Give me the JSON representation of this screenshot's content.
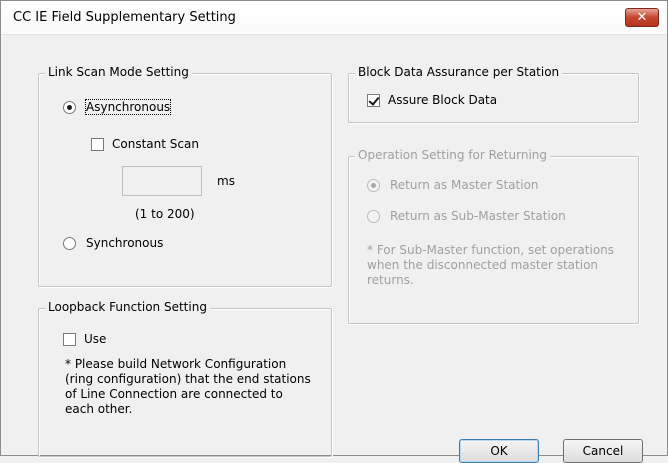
{
  "window": {
    "title": "CC IE Field Supplementary Setting",
    "close_glyph": "✕"
  },
  "link_scan": {
    "group_label": "Link Scan Mode Setting",
    "asynchronous_label": "Asynchronous",
    "asynchronous_selected": true,
    "constant_scan_label": "Constant Scan",
    "constant_scan_checked": false,
    "ms_value": "",
    "ms_unit": "ms",
    "range_hint": "(1 to 200)",
    "synchronous_label": "Synchronous",
    "synchronous_selected": false
  },
  "loopback": {
    "group_label": "Loopback Function Setting",
    "use_label": "Use",
    "use_checked": false,
    "note": "* Please build Network Configuration (ring configuration) that the end stations of Line Connection are connected to each other."
  },
  "block_data": {
    "group_label": "Block Data Assurance per Station",
    "assure_label": "Assure Block Data",
    "assure_checked": true
  },
  "returning": {
    "group_label": "Operation Setting for Returning",
    "enabled": false,
    "master_label": "Return as Master Station",
    "master_selected": true,
    "submaster_label": "Return as Sub-Master Station",
    "submaster_selected": false,
    "note": "* For Sub-Master function, set operations when the disconnected master station returns."
  },
  "buttons": {
    "ok_label": "OK",
    "cancel_label": "Cancel"
  }
}
